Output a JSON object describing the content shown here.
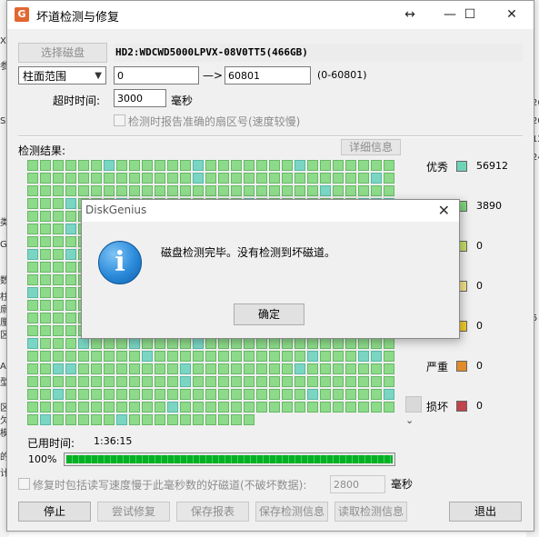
{
  "window": {
    "title": "坏道检测与修复",
    "controls": {
      "resize": "↔",
      "minimize": "—",
      "maximize": "☐",
      "close": "✕"
    }
  },
  "disk": {
    "select_button": "选择磁盘",
    "name": "HD2:WDCWD5000LPVX-08V0TT5(466GB)"
  },
  "range": {
    "mode": "柱面范围",
    "start": "0",
    "arrow": "—>",
    "end": "60801",
    "hint": "(0-60801)"
  },
  "timeout": {
    "label": "超时时间:",
    "value": "3000",
    "unit": "毫秒"
  },
  "accurate_sector": {
    "label": "检测时报告准确的扇区号(速度较慢)"
  },
  "results": {
    "label": "检测结果:",
    "details_button": "详细信息"
  },
  "legend": [
    {
      "name": "优秀",
      "count": "56912",
      "color": "#6fd3b8"
    },
    {
      "name": "",
      "count": "3890",
      "color": "#7fd67c"
    },
    {
      "name": "",
      "count": "0",
      "color": "#c6e06a"
    },
    {
      "name": "",
      "count": "0",
      "color": "#f5e58c"
    },
    {
      "name": "",
      "count": "0",
      "color": "#f4cf2d"
    },
    {
      "name": "严重",
      "count": "0",
      "color": "#e08c2b"
    },
    {
      "name": "损坏",
      "count": "0",
      "color": "#c0454c"
    }
  ],
  "elapsed": {
    "label": "已用时间:",
    "value": "1:36:15"
  },
  "progress": {
    "percent_label": "100%",
    "fraction": 1.0
  },
  "repair_option": {
    "label": "修复时包括读写速度慢于此毫秒数的好磁道(不破坏数据):",
    "value": "2800",
    "unit": "毫秒"
  },
  "buttons": {
    "stop": "停止",
    "try_repair": "尝试修复",
    "save_report": "保存报表",
    "save_info": "保存检测信息",
    "load_info": "读取检测信息",
    "exit": "退出"
  },
  "dialog": {
    "title": "DiskGenius",
    "message": "磁盘检测完毕。没有检测到坏磁道。",
    "ok_button": "确定"
  },
  "background": {
    "left_fragments": [
      "X",
      "参",
      "S",
      "类",
      "G",
      "数",
      "柱",
      "扇",
      "厘",
      "区",
      "A",
      "型",
      "区",
      "欠",
      "模",
      "的",
      "计"
    ],
    "right_fragments": [
      "26",
      "20",
      "12",
      "24",
      "5"
    ]
  }
}
